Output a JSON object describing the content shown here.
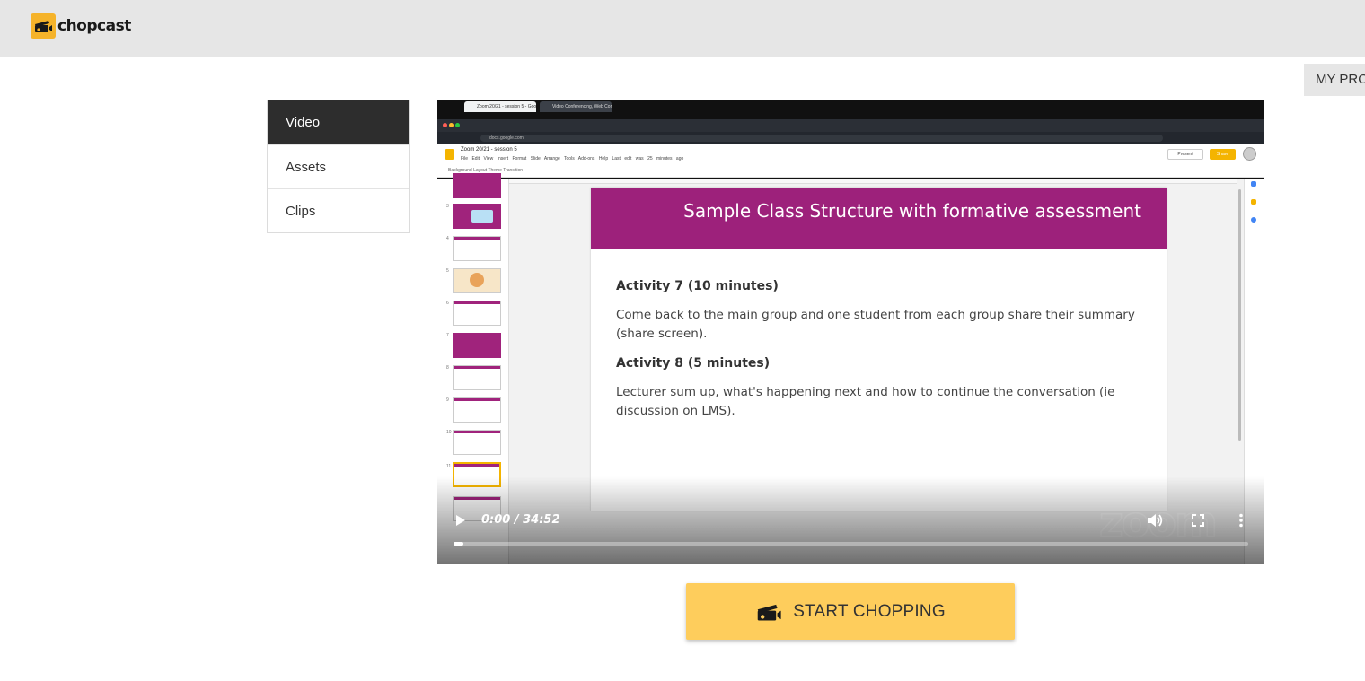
{
  "brand": {
    "name": "chopcast",
    "logo_icon": "clapperboard-icon",
    "accent": "#fecd5c"
  },
  "header": {
    "my_profile_label": "MY PRO"
  },
  "side_nav": {
    "items": [
      {
        "label": "Video",
        "active": true
      },
      {
        "label": "Assets",
        "active": false
      },
      {
        "label": "Clips",
        "active": false
      }
    ]
  },
  "video": {
    "browser": {
      "tab_1": "Zoom 20/21 - session 5 - Goo",
      "tab_2": "Video Conferencing, Web Con",
      "url": "docs.google.com"
    },
    "docs": {
      "title": "Zoom 20/21 - session 5",
      "menu": "File Edit View Insert Format Slide Arrange Tools Add-ons Help Last edit was 25 minutes ago",
      "tools": "Background Layout Theme Transition",
      "present_label": "Present",
      "share_label": "Share"
    },
    "slide": {
      "title": "Sample Class Structure with formative assessment",
      "activity_7_heading": "Activity 7 (10 minutes)",
      "activity_7_text": "Come back to the main group and one student from each group share their summary (share screen).",
      "activity_8_heading": "Activity 8 (5 minutes)",
      "activity_8_text": "Lecturer sum up, what's happening next and how to continue the conversation (ie discussion on LMS).",
      "header_color": "#9d217b"
    },
    "watermark": "zoom",
    "player": {
      "time": "0:00 / 34:52",
      "progress": 0.012,
      "play_icon": "play-icon",
      "volume_icon": "volume-icon",
      "fullscreen_icon": "fullscreen-icon",
      "more_icon": "more-vertical-icon"
    }
  },
  "cta": {
    "label": "START CHOPPING",
    "icon": "clapperboard-icon"
  }
}
